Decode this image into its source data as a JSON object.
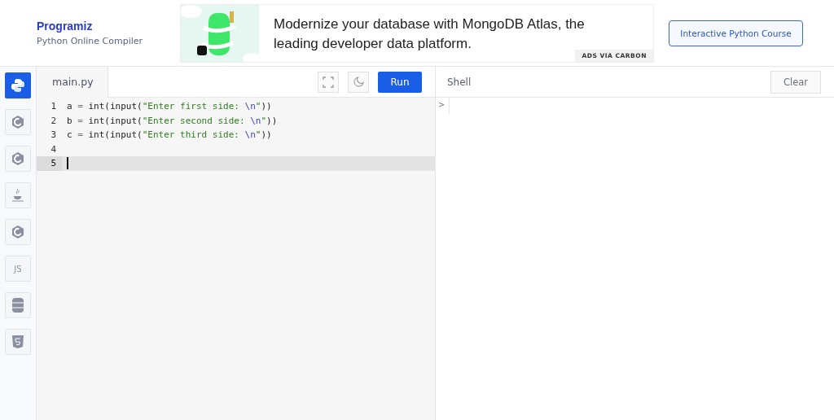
{
  "brand": {
    "logo": "Programiz",
    "subtitle": "Python Online Compiler"
  },
  "ad": {
    "text": "Modernize your database with MongoDB Atlas, the leading developer data platform.",
    "tag": "ADS VIA CARBON"
  },
  "course_button": "Interactive Python Course",
  "sidebar": {
    "items": [
      {
        "kind": "python",
        "selected": true
      },
      {
        "kind": "c",
        "selected": false
      },
      {
        "kind": "cpp",
        "selected": false
      },
      {
        "kind": "java",
        "selected": false
      },
      {
        "kind": "csharp",
        "selected": false
      },
      {
        "kind": "js",
        "label": "JS",
        "selected": false
      },
      {
        "kind": "sql",
        "selected": false
      },
      {
        "kind": "html",
        "selected": false
      }
    ]
  },
  "editor": {
    "file_tab": "main.py",
    "run_button": "Run",
    "lines": [
      {
        "number": "1",
        "active": false,
        "tokens": [
          {
            "kind": "name",
            "text": "a"
          },
          {
            "kind": "op",
            "text": " = "
          },
          {
            "kind": "name",
            "text": "int(input("
          },
          {
            "kind": "string",
            "text": "\"Enter first side: "
          },
          {
            "kind": "escape",
            "text": "\\n"
          },
          {
            "kind": "string",
            "text": "\""
          },
          {
            "kind": "name",
            "text": "))"
          }
        ]
      },
      {
        "number": "2",
        "active": false,
        "tokens": [
          {
            "kind": "name",
            "text": "b"
          },
          {
            "kind": "op",
            "text": " = "
          },
          {
            "kind": "name",
            "text": "int(input("
          },
          {
            "kind": "string",
            "text": "\"Enter second side: "
          },
          {
            "kind": "escape",
            "text": "\\n"
          },
          {
            "kind": "string",
            "text": "\""
          },
          {
            "kind": "name",
            "text": "))"
          }
        ]
      },
      {
        "number": "3",
        "active": false,
        "tokens": [
          {
            "kind": "name",
            "text": "c"
          },
          {
            "kind": "op",
            "text": " = "
          },
          {
            "kind": "name",
            "text": "int(input("
          },
          {
            "kind": "string",
            "text": "\"Enter third side: "
          },
          {
            "kind": "escape",
            "text": "\\n"
          },
          {
            "kind": "string",
            "text": "\""
          },
          {
            "kind": "name",
            "text": "))"
          }
        ]
      },
      {
        "number": "4",
        "active": false
      },
      {
        "number": "5",
        "active": true
      }
    ]
  },
  "shell": {
    "title": "Shell",
    "clear_button": "Clear",
    "prompt": ">"
  }
}
